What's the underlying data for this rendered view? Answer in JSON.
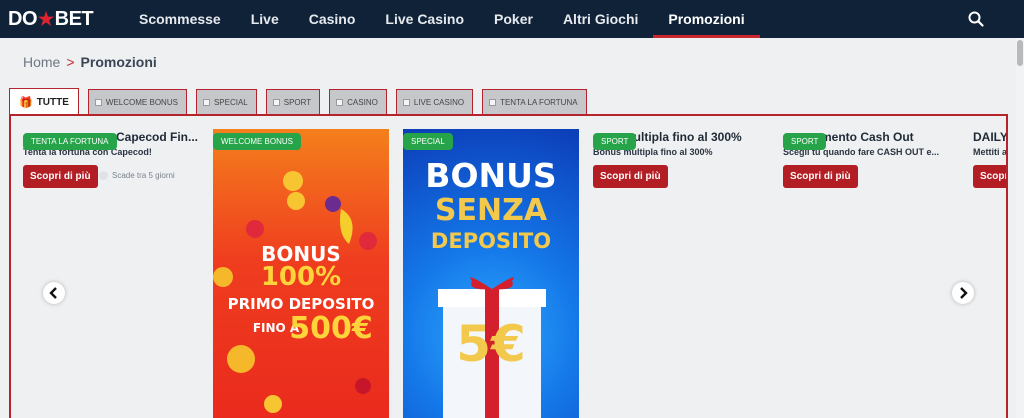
{
  "brand": {
    "logo_left": "DO",
    "logo_right": "BET"
  },
  "nav": {
    "items": [
      "Scommesse",
      "Live",
      "Casino",
      "Live Casino",
      "Poker",
      "Altri Giochi",
      "Promozioni"
    ],
    "active": "Promozioni",
    "accent_color": "#c9262e"
  },
  "breadcrumb": {
    "home": "Home",
    "separator": ">",
    "current": "Promozioni"
  },
  "tabs": [
    "TUTTE",
    "WELCOME BONUS",
    "SPECIAL",
    "SPORT",
    "CASINO",
    "LIVE CASINO",
    "TENTA LA FORTUNA"
  ],
  "promos": [
    {
      "badge": "TENTA LA FORTUNA",
      "title": "Capecod Fin...",
      "subtitle": "Tenta la fortuna con Capecod!",
      "cta": "Scopri di più",
      "expiry": "Scade tra 5 giorni"
    },
    {
      "badge": "WELCOME BONUS",
      "banner_lines": [
        "BONUS",
        "100%",
        "PRIMO DEPOSITO",
        "FINO A",
        "500€"
      ]
    },
    {
      "badge": "SPECIAL",
      "banner_lines": [
        "BONUS",
        "SENZA",
        "DEPOSITO",
        "5€"
      ]
    },
    {
      "badge": "SPORT",
      "title": "multipla fino al 300%",
      "subtitle": "Bonus multipla fino al 300%",
      "cta": "Scopri di più"
    },
    {
      "badge": "SPORT",
      "title": "mento Cash Out",
      "subtitle": "Scegli tu quando fare CASH OUT e...",
      "cta": "Scopri di più"
    },
    {
      "title": "DAILY",
      "subtitle": "Mettiti a",
      "cta": "Scopr"
    }
  ],
  "colors": {
    "header_bg": "#0f2238",
    "badge_green": "#27a34a",
    "cta_red": "#b31e24",
    "frame_red": "#b4242c"
  },
  "icons": {
    "search": "search-icon",
    "prev": "chevron-left-icon",
    "next": "chevron-right-icon",
    "gift": "gift-icon"
  }
}
